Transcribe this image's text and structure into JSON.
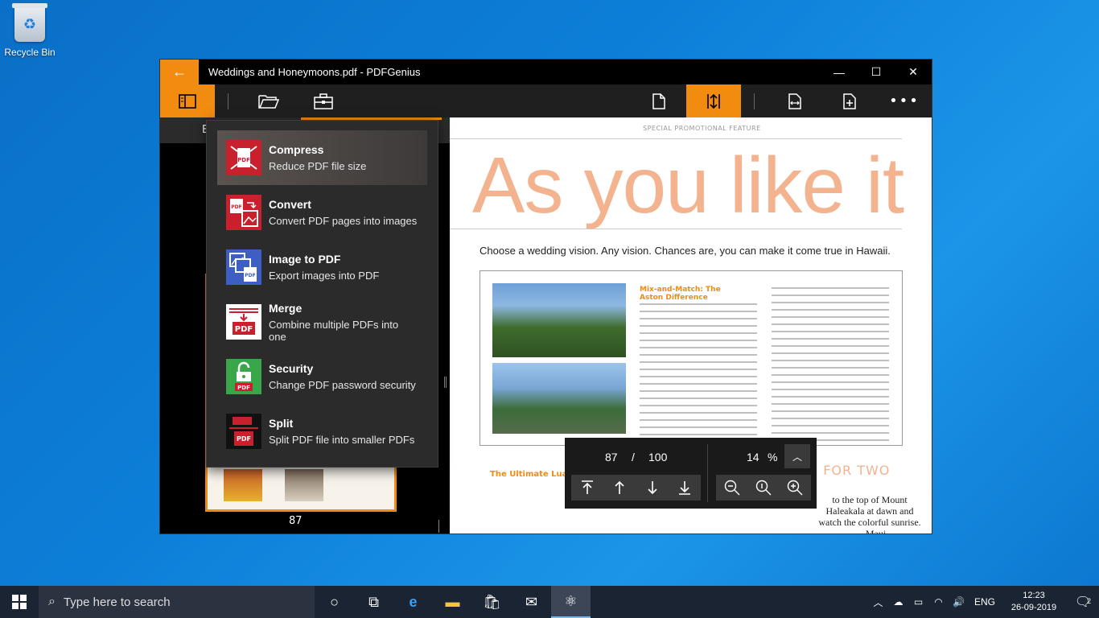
{
  "desktop": {
    "recycle_bin_label": "Recycle Bin"
  },
  "window": {
    "title": "Weddings and Honeymoons.pdf - PDFGenius",
    "accent_color": "#f28c11",
    "controls": {
      "minimize": "—",
      "maximize": "☐",
      "close": "✕"
    }
  },
  "sidebar": {
    "tab_partial": "B",
    "thumbnail_page_label": "87"
  },
  "tools_menu": {
    "items": [
      {
        "name": "Compress",
        "description": "Reduce PDF file size",
        "icon": "compress-icon",
        "color": "#c8202c"
      },
      {
        "name": "Convert",
        "description": "Convert PDF pages into images",
        "icon": "convert-icon",
        "color": "#c8202c"
      },
      {
        "name": "Image to PDF",
        "description": "Export images into PDF",
        "icon": "image-to-pdf-icon",
        "color": "#3d5fc4"
      },
      {
        "name": "Merge",
        "description": "Combine multiple PDFs into one",
        "icon": "merge-icon",
        "color": "#ffffff"
      },
      {
        "name": "Security",
        "description": "Change PDF password security",
        "icon": "security-icon",
        "color": "#3aa64a"
      },
      {
        "name": "Split",
        "description": "Split PDF file into smaller PDFs",
        "icon": "split-icon",
        "color": "#111111"
      }
    ]
  },
  "document": {
    "feature_label": "SPECIAL PROMOTIONAL FEATURE",
    "headline": "As you like it",
    "subheadline": "Choose a wedding vision. Any vision. Chances are, you can make it come true in Hawaii.",
    "article_heading": "Mix-and-Match: The Aston Difference",
    "article2_heading": "The Ultimate Luau",
    "article2_pink": "E FOR TWO",
    "quote": "to the top of Mount Haleakala at dawn and watch the colorful sunrise. — Maui"
  },
  "navigator": {
    "current_page": "87",
    "separator": "/",
    "total_pages": "100",
    "zoom_value": "14",
    "zoom_unit": "%"
  },
  "taskbar": {
    "search_placeholder": "Type here to search",
    "language": "ENG",
    "time": "12:23",
    "date": "26-09-2019",
    "notification_count": "2"
  }
}
